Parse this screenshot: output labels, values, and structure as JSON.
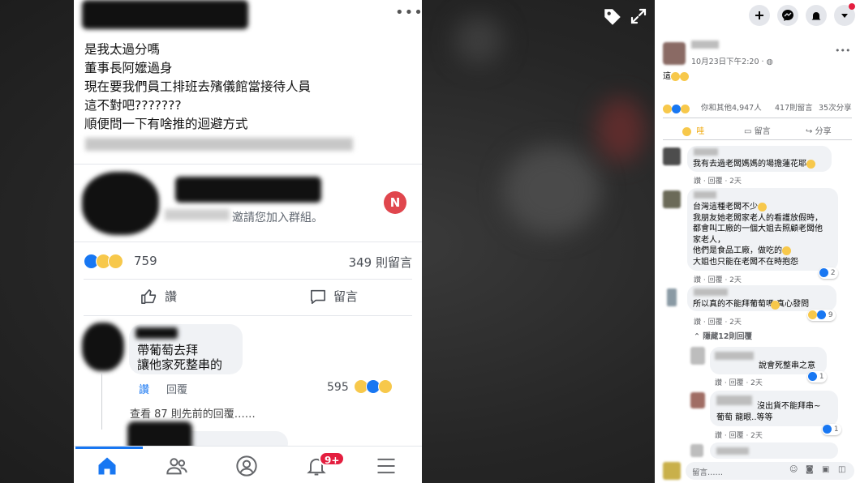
{
  "post": {
    "lines": [
      "是我太過分嗎",
      "董事長阿嬤過身",
      "現在要我們員工排班去殯儀館當接待人員",
      "這不對吧???????",
      "順便問一下有啥推的迴避方式"
    ],
    "invite_text": "邀請您加入群組。",
    "invite_badge": "N",
    "reaction_count": "759",
    "comment_count": "349 則留言",
    "like_label": "讚",
    "comment_label": "留言"
  },
  "comment1": {
    "line1": "帶葡萄去拜",
    "line2": "讓他家死整串的",
    "like_link": "讚",
    "reply_link": "回覆",
    "reaction_count": "595"
  },
  "view_previous": "查看 87 則先前的回覆……",
  "bottom_nav": {
    "notification_badge": "9+",
    "icons": [
      "home-icon",
      "friends-icon",
      "profile-icon",
      "bell-icon",
      "menu-icon"
    ]
  },
  "sidebar": {
    "post_time": "10月23日下午2:20 · ",
    "post_text": "這",
    "reactions_text": "你和其他4,947人",
    "comments_text": "417則留言",
    "shares_text": "35次分享",
    "action_wow": "哇",
    "action_comment": "留言",
    "action_share": "分享",
    "comments": [
      {
        "text": "我有去過老闆媽媽的場擔蓮花耶",
        "meta": "讚 · 回覆 · 2天"
      },
      {
        "text_lines": [
          "台灣這種老闆不少",
          "我朋友她老闆家老人的看護放假時，",
          "都會叫工廠的一個大姐去照顧老闆他",
          "家老人，",
          "他們是食品工廠，做吃的",
          "大姐也只能在老闆不在時抱怨"
        ],
        "likes": "2",
        "meta": "讚 · 回覆 · 2天"
      },
      {
        "text": "所以真的不能拜葡萄嗎  真心發問",
        "likes": "9",
        "meta": "讚 · 回覆 · 2天"
      }
    ],
    "hide_replies": "隱藏12則回覆",
    "replies": [
      {
        "text": "說會死整串之意",
        "likes": "1",
        "meta": "讚 · 回覆 · 2天"
      },
      {
        "text_lines": [
          "沒出貨不能拜串~",
          "葡萄 龍眼..等等"
        ],
        "likes": "1",
        "meta": "讚 · 回覆 · 2天"
      }
    ],
    "input_placeholder": "留言……"
  },
  "colors": {
    "facebook_blue": "#1877f2",
    "notification_red": "#e41e3f",
    "bubble_gray": "#f0f2f5"
  }
}
